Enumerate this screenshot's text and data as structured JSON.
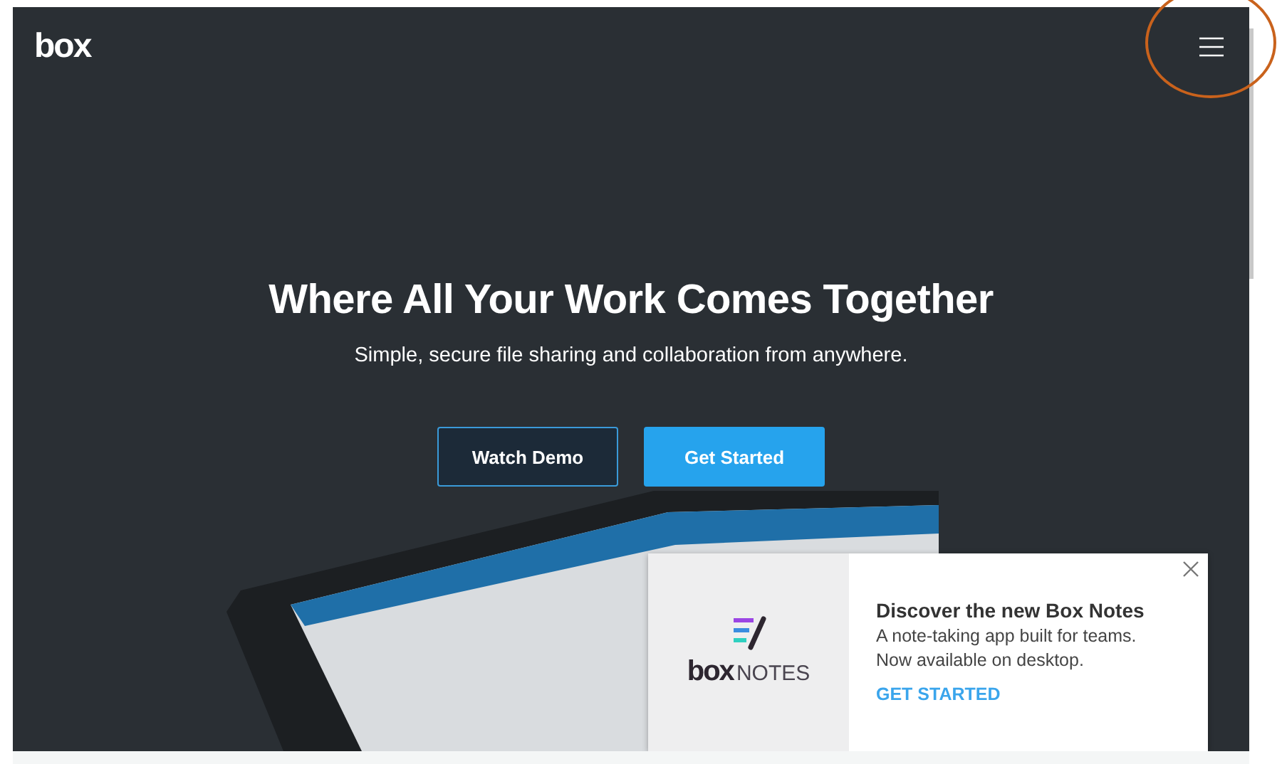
{
  "header": {
    "logo": "box"
  },
  "hero": {
    "title": "Where All Your Work Comes Together",
    "subtitle": "Simple, secure file sharing and collaboration from anywhere.",
    "buttons": [
      {
        "label": "Watch Demo",
        "kind": "outline"
      },
      {
        "label": "Get Started",
        "kind": "primary"
      }
    ]
  },
  "popup": {
    "logo_word": "box",
    "logo_product": "NOTES",
    "title": "Discover the new Box Notes",
    "lines": [
      "A note-taking app built for teams.",
      "Now available on desktop."
    ],
    "cta": "GET STARTED"
  }
}
